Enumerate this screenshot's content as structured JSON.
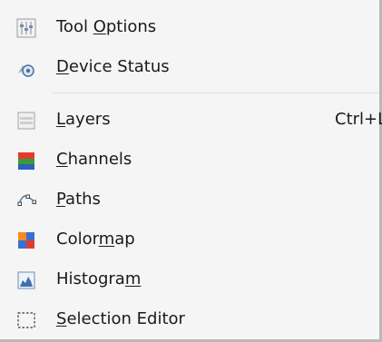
{
  "menu": {
    "items": [
      {
        "label_pre": "Tool ",
        "label_u": "O",
        "label_post": "ptions",
        "icon": "tool-options-icon"
      },
      {
        "label_pre": "",
        "label_u": "D",
        "label_post": "evice Status",
        "icon": "device-status-icon"
      },
      {
        "label_pre": "",
        "label_u": "L",
        "label_post": "ayers",
        "shortcut": "Ctrl+L",
        "icon": "layers-icon"
      },
      {
        "label_pre": "",
        "label_u": "C",
        "label_post": "hannels",
        "icon": "channels-icon"
      },
      {
        "label_pre": "",
        "label_u": "P",
        "label_post": "aths",
        "icon": "paths-icon"
      },
      {
        "label_pre": "Color",
        "label_u": "m",
        "label_post": "ap",
        "icon": "colormap-icon"
      },
      {
        "label_pre": "Histogra",
        "label_u": "m",
        "label_post": "",
        "icon": "histogram-icon"
      },
      {
        "label_pre": "",
        "label_u": "S",
        "label_post": "election Editor",
        "icon": "selection-editor-icon"
      }
    ]
  }
}
